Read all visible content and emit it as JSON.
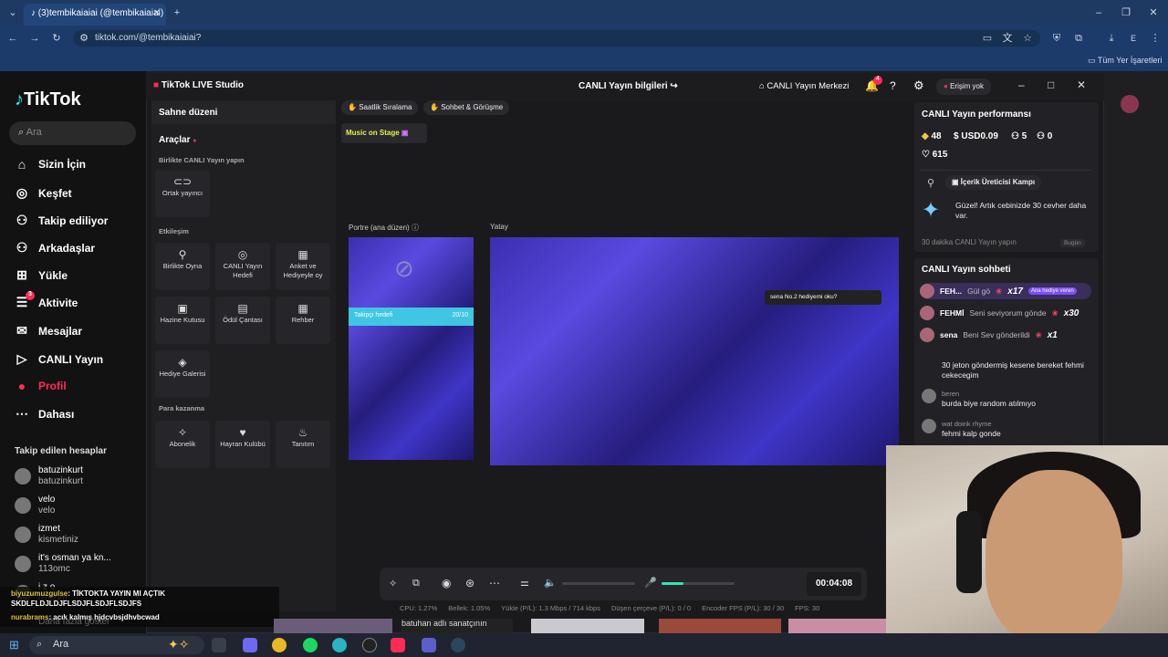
{
  "browser": {
    "tab_title": "(3)tembikaiaiai (@tembikaiaiai)",
    "url": "tiktok.com/@tembikaiaiai?",
    "bookmarks": "Tüm Yer İşaretleri",
    "profile_initial": "E"
  },
  "tiktok": {
    "logo": "TikTok",
    "search_placeholder": "Ara",
    "nav": [
      {
        "label": "Sizin İçin",
        "icon": "home-icon"
      },
      {
        "label": "Keşfet",
        "icon": "compass-icon"
      },
      {
        "label": "Takip ediliyor",
        "icon": "person-add-icon"
      },
      {
        "label": "Arkadaşlar",
        "icon": "friends-icon"
      },
      {
        "label": "Yükle",
        "icon": "plus-square-icon"
      },
      {
        "label": "Aktivite",
        "icon": "activity-icon",
        "badge": "3"
      },
      {
        "label": "Mesajlar",
        "icon": "message-icon"
      },
      {
        "label": "CANLI Yayın",
        "icon": "live-icon"
      },
      {
        "label": "Profil",
        "icon": "profile-avatar",
        "active": true
      },
      {
        "label": "Dahası",
        "icon": "more-icon"
      }
    ],
    "following_header": "Takip edilen hesaplar",
    "following": [
      {
        "name": "batuzinkurt",
        "sub": "batuzinkurt"
      },
      {
        "name": "velo",
        "sub": "velo"
      },
      {
        "name": "izmet",
        "sub": "kismetiniz"
      },
      {
        "name": "it's osman ya kn...",
        "sub": "113omc"
      },
      {
        "name": "i z o",
        "sub": "izocum"
      }
    ],
    "more_link": "Daha fazla göster"
  },
  "studio": {
    "app_name": "TikTok LIVE Studio",
    "center_title": "CANLI Yayın bilgileri",
    "center_btn": "CANLI Yayın Merkezi",
    "bell_badge": "4",
    "access": "Erişim yok",
    "scene_header": "Sahne düzeni",
    "tools_header": "Araçlar",
    "sec_together": "Birlikte CANLI Yayın yapın",
    "card_cohost": "Ortak yayıncı",
    "sec_interaction": "Etkileşim",
    "cards_interaction": [
      "Birlikte Oyna",
      "CANLI Yayın Hedefi",
      "Anket ve Hediyeyle oy",
      "Hazine Kutusu",
      "Ödül Çantası",
      "Rehber",
      "Hediye Galerisi"
    ],
    "sec_earn": "Para kazanma",
    "cards_earn": [
      "Abonelik",
      "Hayran Kulübü",
      "Tanıtım"
    ],
    "top_pills": [
      "Saatlik Sıralama",
      "Sohbet & Görüşme"
    ],
    "music_stage": "Music on Stage",
    "portrait_label": "Portre (ana düzen)",
    "landscape_label": "Yatay",
    "portrait_goal_text": "Takipçi hedefi",
    "portrait_goal_count": "20/10",
    "landscape_overlay": "sena  No.2  hediyemi oku?",
    "perf_header": "CANLI Yayın performansı",
    "perf_diamonds": "48",
    "perf_usd": "USD0.09",
    "perf_viewers": "5",
    "perf_zero": "0",
    "perf_likes": "615",
    "camp_btn": "İçerik Üreticisi Kampı",
    "camp_msg": "Güzel! Artık cebinizde 30 cevher daha var.",
    "camp_foot": "30 dakika CANLI Yayın yapın",
    "camp_date": "Bugün",
    "chat_header": "CANLI Yayın sohbeti",
    "gifts": [
      {
        "user": "FEH...",
        "text": "Gül gö",
        "mult": "x17",
        "tag": "Ana hediye veren"
      },
      {
        "user": "FEHMİ",
        "text": "Seni seviyorum gönde",
        "mult": "x30"
      },
      {
        "user": "sena",
        "text": "Beni Sev gönderildi",
        "mult": "x1"
      }
    ],
    "chat": [
      {
        "user": "",
        "msg": "30 jeton göndermiş kesene bereket fehmi cekecegim"
      },
      {
        "user": "beren",
        "msg": "burda biye random atılmıyo"
      },
      {
        "user": "wat doink rhyme",
        "msg": "fehmi kalp gonde"
      }
    ],
    "timer": "00:04:08",
    "stats": [
      "CPU: 1.27%",
      "Bellek: 1.05%",
      "Yükle (P/L): 1.3 Mbps / 714 kbps",
      "Düşen çerçeve (P/L): 0 / 0",
      "Encoder FPS (P/L): 30 / 30",
      "FPS: 30"
    ]
  },
  "overlay_chat": [
    {
      "user": "biyuzumuzgulse",
      "msg": ": TİKTOKTA YAYIN MI AÇTIK SKDLFLDJLDJFLSDJFLSDJFLSDJFS"
    },
    {
      "user": "nurabrams",
      "msg": ": acık kalmış hjdcvbsjdhvbcwad"
    }
  ],
  "taskbar": {
    "search": "Ara",
    "thumb_caption": "batuhan adlı sanatçının"
  },
  "colors": {
    "accent": "#fe2c55",
    "studio_bg": "#1a1a1c",
    "browser_bar": "#1c3a6a",
    "taskbar": "#1f2430"
  }
}
